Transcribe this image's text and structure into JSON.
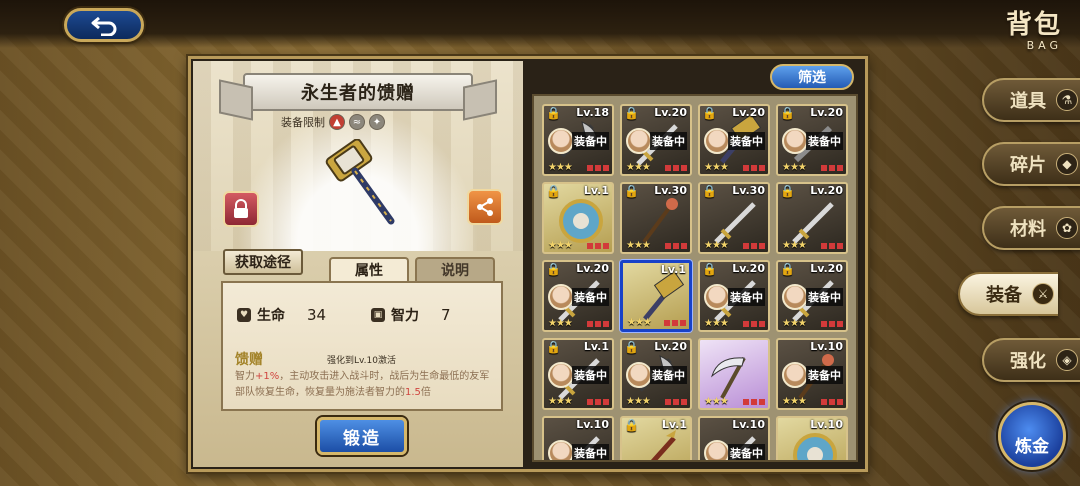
{
  "header": {
    "back_icon": "return-arrow-icon",
    "title_cn": "背包",
    "title_en": "BAG"
  },
  "item": {
    "name": "永生者的馈赠",
    "equip_limit_label": "装备限制",
    "acquire_label": "获取途径",
    "tabs": [
      "属性",
      "说明"
    ],
    "active_tab": "属性",
    "stats": [
      {
        "label": "生命",
        "value": "34"
      },
      {
        "label": "智力",
        "value": "7"
      }
    ],
    "gift": {
      "title": "馈赠",
      "unlock": "强化到Lv.10激活",
      "desc_prefix": "智力",
      "desc_bonus": "+1%",
      "desc_mid": "，主动攻击进入战斗时，战后为生命最低的友军部队恢复生命，恢复量为施法者智力的",
      "desc_mult": "1.5",
      "desc_suffix": "倍"
    },
    "forge_label": "锻造"
  },
  "inventory": {
    "filter_label": "筛选",
    "equipped_label": "装备中",
    "cells": [
      {
        "lv": "Lv.18",
        "locked": true,
        "equipped": true,
        "rarity": "dark",
        "weapon": "axe",
        "stars": "★★★"
      },
      {
        "lv": "Lv.20",
        "locked": true,
        "equipped": true,
        "rarity": "dark",
        "weapon": "sword",
        "stars": "★★★"
      },
      {
        "lv": "Lv.20",
        "locked": true,
        "equipped": true,
        "rarity": "dark",
        "weapon": "hammer",
        "stars": "★★★"
      },
      {
        "lv": "Lv.20",
        "locked": true,
        "equipped": true,
        "rarity": "dark",
        "weapon": "blade",
        "stars": "★★★"
      },
      {
        "lv": "Lv.1",
        "locked": true,
        "equipped": false,
        "rarity": "gold",
        "weapon": "shield",
        "stars": "★★★"
      },
      {
        "lv": "Lv.30",
        "locked": true,
        "equipped": false,
        "rarity": "dark",
        "weapon": "staff",
        "stars": "★★★"
      },
      {
        "lv": "Lv.30",
        "locked": true,
        "equipped": false,
        "rarity": "dark",
        "weapon": "sword",
        "stars": "★★★"
      },
      {
        "lv": "Lv.20",
        "locked": true,
        "equipped": false,
        "rarity": "dark",
        "weapon": "sword",
        "stars": "★★★"
      },
      {
        "lv": "Lv.20",
        "locked": true,
        "equipped": true,
        "rarity": "dark",
        "weapon": "sword",
        "stars": "★★★"
      },
      {
        "lv": "Lv.1",
        "locked": false,
        "equipped": false,
        "rarity": "gold",
        "weapon": "hammer",
        "stars": "★★★",
        "selected": true
      },
      {
        "lv": "Lv.20",
        "locked": true,
        "equipped": true,
        "rarity": "dark",
        "weapon": "sword",
        "stars": "★★★"
      },
      {
        "lv": "Lv.20",
        "locked": true,
        "equipped": true,
        "rarity": "dark",
        "weapon": "sword",
        "stars": "★★★"
      },
      {
        "lv": "Lv.1",
        "locked": true,
        "equipped": true,
        "rarity": "dark",
        "weapon": "sword",
        "stars": "★★★"
      },
      {
        "lv": "Lv.20",
        "locked": true,
        "equipped": true,
        "rarity": "dark",
        "weapon": "axe",
        "stars": "★★★"
      },
      {
        "lv": "",
        "locked": false,
        "equipped": false,
        "rarity": "purple",
        "weapon": "scythe",
        "stars": "★★★"
      },
      {
        "lv": "Lv.10",
        "locked": false,
        "equipped": true,
        "rarity": "dark",
        "weapon": "staff",
        "stars": "★★★"
      },
      {
        "lv": "Lv.10",
        "locked": false,
        "equipped": true,
        "rarity": "dark",
        "weapon": "sword",
        "stars": "★★★"
      },
      {
        "lv": "Lv.1",
        "locked": true,
        "equipped": false,
        "rarity": "gold",
        "weapon": "spear",
        "stars": "★★★"
      },
      {
        "lv": "Lv.10",
        "locked": false,
        "equipped": true,
        "rarity": "dark",
        "weapon": "sword",
        "stars": "★★★"
      },
      {
        "lv": "Lv.10",
        "locked": false,
        "equipped": false,
        "rarity": "gold",
        "weapon": "shield",
        "stars": "★★★"
      }
    ]
  },
  "side_nav": [
    {
      "label": "道具",
      "icon": "flask-icon",
      "active": false
    },
    {
      "label": "碎片",
      "icon": "shard-icon",
      "active": false
    },
    {
      "label": "材料",
      "icon": "material-icon",
      "active": false
    },
    {
      "label": "装备",
      "icon": "equipment-icon",
      "active": true
    },
    {
      "label": "强化",
      "icon": "enhance-icon",
      "active": false
    }
  ],
  "alchemy_label": "炼金",
  "colors": {
    "accent_blue": "#1c4ea6",
    "gold_trim": "#d5b76a",
    "highlight_red": "#d0453f"
  }
}
